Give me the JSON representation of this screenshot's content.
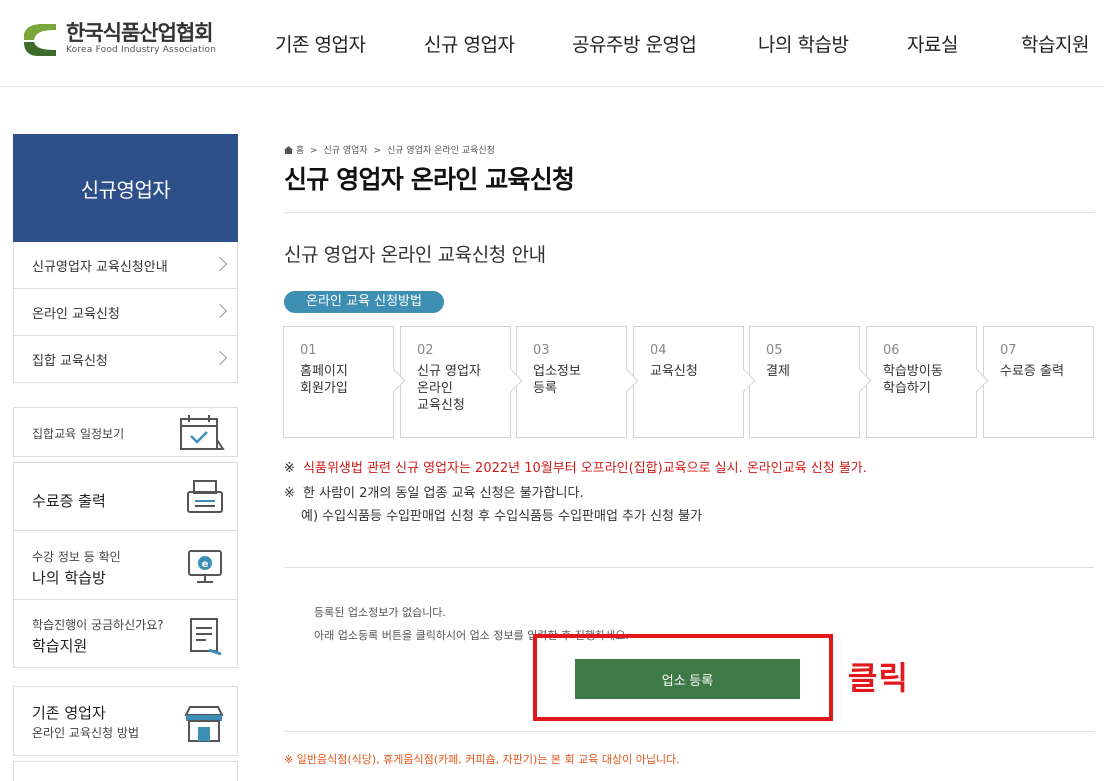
{
  "header": {
    "logo_ko": "한국식품산업협회",
    "logo_en": "Korea Food Industry Association",
    "nav": [
      "기존 영업자",
      "신규 영업자",
      "공유주방 운영업",
      "나의 학습방",
      "자료실",
      "학습지원"
    ]
  },
  "sidebar": {
    "title": "신규영업자",
    "items": [
      "신규영업자 교육신청안내",
      "온라인 교육신청",
      "집합 교육신청"
    ],
    "quick": {
      "schedule": "집합교육 일정보기",
      "cert": "수료증 출력",
      "mypage_small": "수강 정보 등 확인",
      "mypage": "나의 학습방",
      "support_small": "학습진행이 궁금하신가요?",
      "support": "학습지원",
      "existing": "기존 영업자",
      "existing_small": "온라인 교육신청 방법"
    }
  },
  "breadcrumb": [
    "홈",
    "신규 영업자",
    "신규 영업자 온라인 교육신청"
  ],
  "page_title": "신규 영업자 온라인 교육신청",
  "section_title": "신규 영업자 온라인 교육신청 안내",
  "method_badge": "온라인 교육 신청방법",
  "steps": [
    {
      "num": "01",
      "label": "홈페이지\n회원가입"
    },
    {
      "num": "02",
      "label": "신규 영업자\n온라인\n교육신청"
    },
    {
      "num": "03",
      "label": "업소정보\n등록"
    },
    {
      "num": "04",
      "label": "교육신청"
    },
    {
      "num": "05",
      "label": "결제"
    },
    {
      "num": "06",
      "label": "학습방이동\n학습하기"
    },
    {
      "num": "07",
      "label": "수료증 출력"
    }
  ],
  "notes": {
    "mark": "※",
    "red_note": "식품위생법 관련 신규 영업자는 2022년 10월부터 오프라인(집합)교육으로 실시. 온라인교육 신청 불가.",
    "note2": "한 사람이 2개의 동일 업종 교육 신청은 불가합니다.",
    "note3": "예) 수입식품등 수입판매업 신청 후 수입식품등 수입판매업 추가 신청 불가"
  },
  "registration": {
    "msg1": "등록된 업소정보가 없습니다.",
    "msg2": "아래 업소등록 버튼을 클릭하시어 업소 정보를 입력한 후 진행하세요.",
    "button": "업소 등록",
    "callout": "클릭"
  },
  "footer_note": "※ 일반음식점(식당), 휴게음식점(카페, 커피숍, 자판기)는 본 회 교육 대상이 아닙니다.",
  "colors": {
    "side_title_bg": "#2d4f8a",
    "badge": "#3f8fb2",
    "button": "#3d7a45",
    "highlight": "#e2181b",
    "warning": "#d01a1a"
  }
}
